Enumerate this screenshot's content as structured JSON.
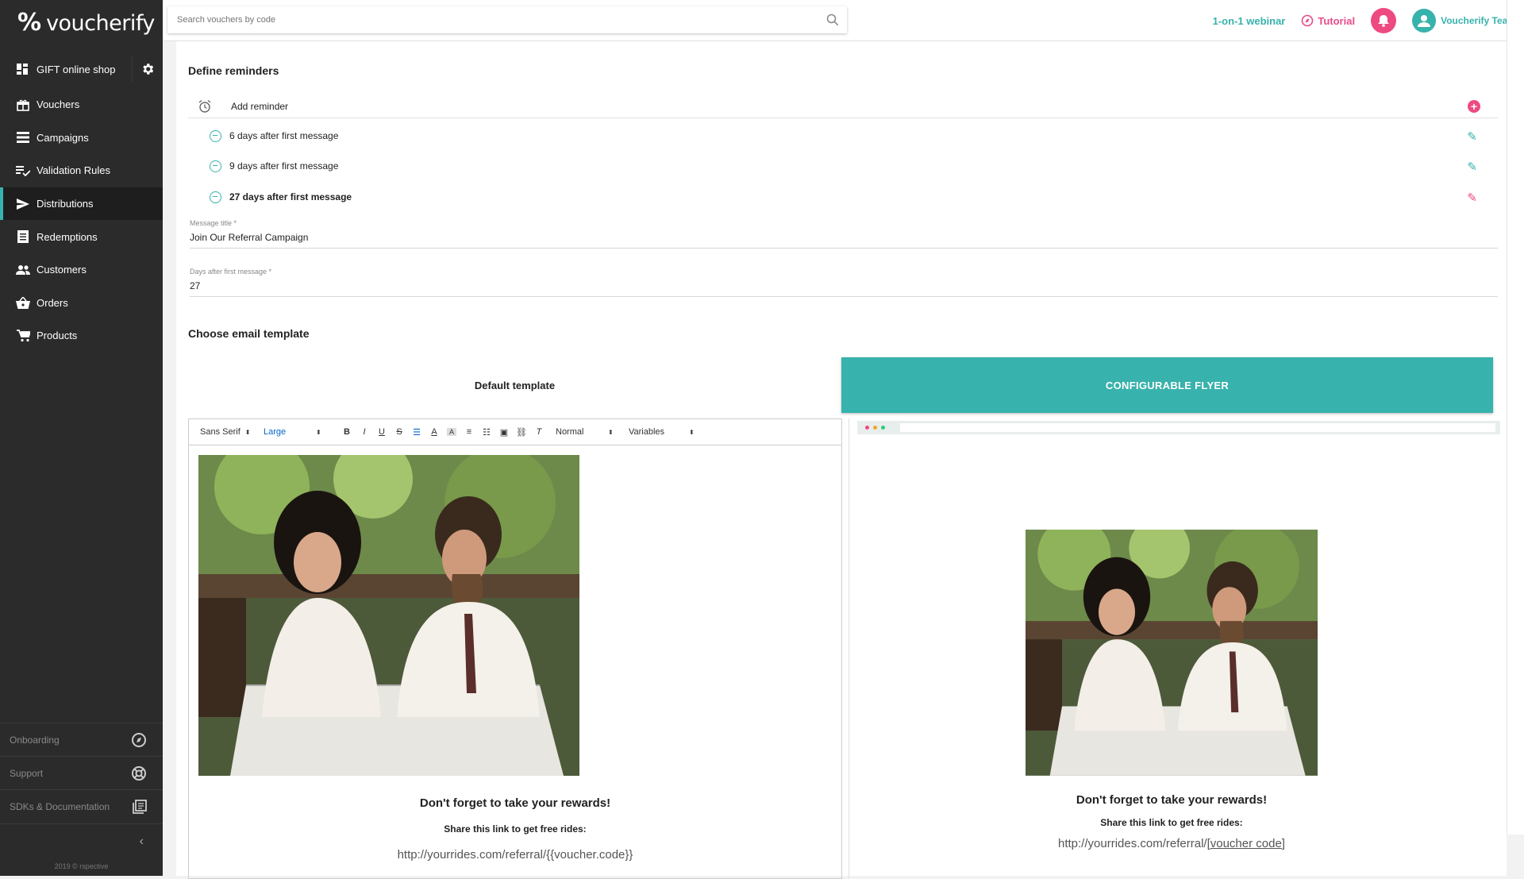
{
  "brand": {
    "name": "voucherify",
    "accent": "#38b2ac",
    "pink": "#ee4a82"
  },
  "sidebar": {
    "shop": "GIFT online shop",
    "items": [
      {
        "label": "Vouchers",
        "icon": "gift-icon"
      },
      {
        "label": "Campaigns",
        "icon": "list-icon"
      },
      {
        "label": "Validation Rules",
        "icon": "checklist-icon"
      },
      {
        "label": "Distributions",
        "icon": "send-icon",
        "active": true
      },
      {
        "label": "Redemptions",
        "icon": "receipt-icon"
      },
      {
        "label": "Customers",
        "icon": "people-icon"
      },
      {
        "label": "Orders",
        "icon": "basket-icon"
      },
      {
        "label": "Products",
        "icon": "cart-icon"
      }
    ],
    "bottom": [
      {
        "label": "Onboarding",
        "icon": "compass-icon"
      },
      {
        "label": "Support",
        "icon": "lifebuoy-icon"
      },
      {
        "label": "SDKs & Documentation",
        "icon": "library-icon"
      }
    ],
    "copyright": "2019 © rspective"
  },
  "topbar": {
    "search_placeholder": "Search vouchers by code",
    "webinar": "1-on-1 webinar",
    "tutorial": "Tutorial",
    "team": "Voucherify Team"
  },
  "reminders": {
    "title": "Define reminders",
    "add_label": "Add reminder",
    "items": [
      {
        "label": "6 days after first message"
      },
      {
        "label": "9 days after first message"
      },
      {
        "label": "27 days after first message",
        "selected": true
      }
    ],
    "message_title_label": "Message title *",
    "message_title_value": "Join Our Referral Campaign",
    "days_label": "Days after first message *",
    "days_value": "27"
  },
  "template": {
    "title": "Choose email template",
    "tab_default": "Default template",
    "tab_flyer": "CONFIGURABLE FLYER",
    "toolbar": {
      "font": "Sans Serif",
      "size": "Large",
      "heading": "Normal",
      "variables": "Variables"
    },
    "email": {
      "headline": "Don't forget to take your rewards!",
      "subline": "Share this link to get free rides:",
      "link": "http://yourrides.com/referral/{{voucher.code}}"
    },
    "preview": {
      "headline": "Don't forget to take your rewards!",
      "subline": "Share this link to get free rides:",
      "link_prefix": "http://yourrides.com/referral/",
      "link_code": "[voucher code]"
    }
  }
}
